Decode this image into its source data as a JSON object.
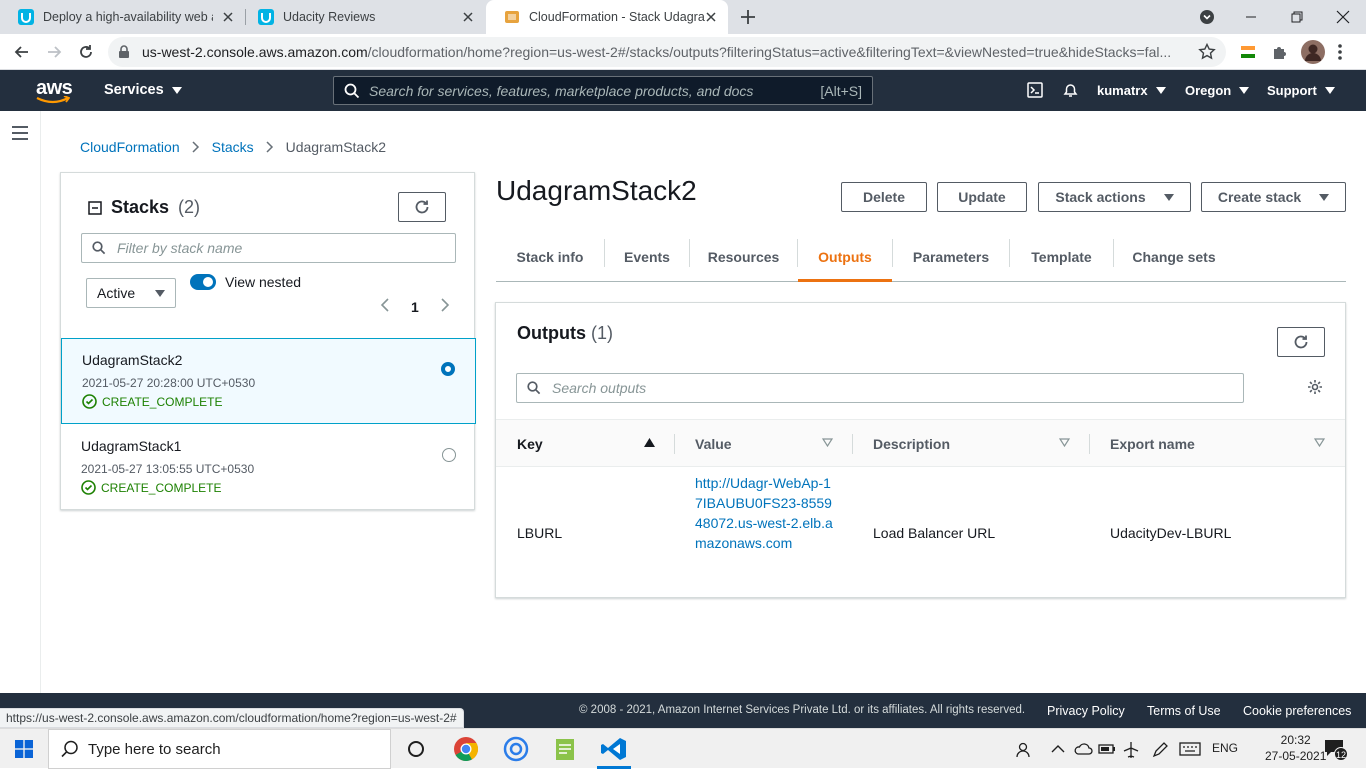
{
  "browser": {
    "tabs": [
      {
        "title": "Deploy a high-availability web ap",
        "active": false
      },
      {
        "title": "Udacity Reviews",
        "active": false
      },
      {
        "title": "CloudFormation - Stack Udagram",
        "active": true
      }
    ],
    "url_host": "us-west-2.console.aws.amazon.com",
    "url_path": "/cloudformation/home?region=us-west-2#/stacks/outputs?filteringStatus=active&filteringText=&viewNested=true&hideStacks=fal...",
    "status_url": "https://us-west-2.console.aws.amazon.com/cloudformation/home?region=us-west-2#"
  },
  "aws_nav": {
    "logo": "aws",
    "services_label": "Services",
    "search_placeholder": "Search for services, features, marketplace products, and docs",
    "search_shortcut": "[Alt+S]",
    "user": "kumatrx",
    "region": "Oregon",
    "support": "Support"
  },
  "breadcrumb": [
    "CloudFormation",
    "Stacks",
    "UdagramStack2"
  ],
  "stacks_panel": {
    "title": "Stacks",
    "count": "(2)",
    "filter_placeholder": "Filter by stack name",
    "status_filter": "Active",
    "view_nested_label": "View nested",
    "page": "1",
    "stacks": [
      {
        "name": "UdagramStack2",
        "date": "2021-05-27 20:28:00 UTC+0530",
        "status": "CREATE_COMPLETE",
        "selected": true
      },
      {
        "name": "UdagramStack1",
        "date": "2021-05-27 13:05:55 UTC+0530",
        "status": "CREATE_COMPLETE",
        "selected": false
      }
    ]
  },
  "detail": {
    "title": "UdagramStack2",
    "buttons": {
      "delete": "Delete",
      "update": "Update",
      "stack_actions": "Stack actions",
      "create_stack": "Create stack"
    },
    "tabs": [
      "Stack info",
      "Events",
      "Resources",
      "Outputs",
      "Parameters",
      "Template",
      "Change sets"
    ],
    "active_tab": "Outputs"
  },
  "outputs": {
    "title": "Outputs",
    "count": "(1)",
    "search_placeholder": "Search outputs",
    "columns": [
      "Key",
      "Value",
      "Description",
      "Export name"
    ],
    "rows": [
      {
        "key": "LBURL",
        "value": "http://Udagr-WebAp-17IBAUBU0FS23-855948072.us-west-2.elb.amazonaws.com",
        "description": "Load Balancer URL",
        "export_name": "UdacityDev-LBURL"
      }
    ]
  },
  "footer": {
    "copyright": "© 2008 - 2021, Amazon Internet Services Private Ltd. or its affiliates. All rights reserved.",
    "links": [
      "Privacy Policy",
      "Terms of Use",
      "Cookie preferences"
    ]
  },
  "taskbar": {
    "search_placeholder": "Type here to search",
    "lang": "ENG",
    "time": "20:32",
    "date": "27-05-2021",
    "notifications": "12"
  },
  "colors": {
    "aws_nav": "#232f3e",
    "link": "#0073bb",
    "accent": "#ec7211",
    "success": "#1d8102"
  }
}
